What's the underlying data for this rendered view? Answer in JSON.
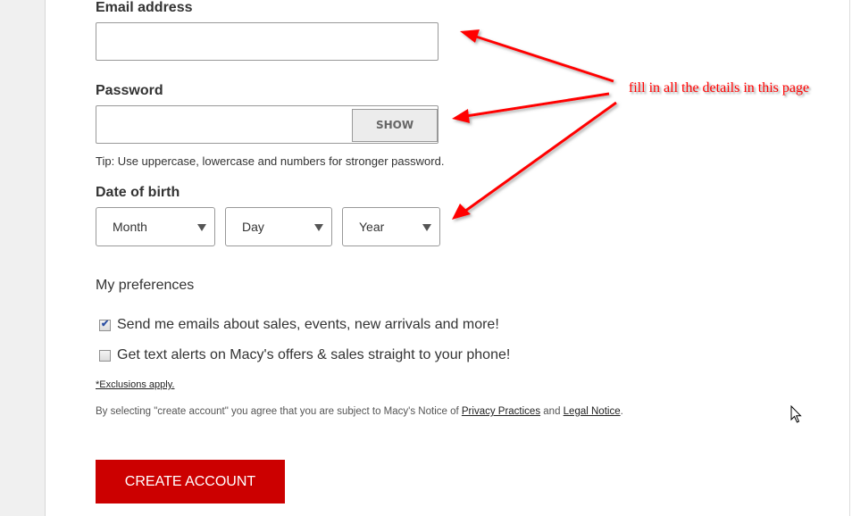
{
  "form": {
    "email": {
      "label": "Email address",
      "value": "",
      "placeholder": ""
    },
    "password": {
      "label": "Password",
      "value": "",
      "placeholder": "",
      "show_button": "SHOW",
      "tip": "Tip: Use uppercase, lowercase and numbers for stronger password."
    },
    "dob": {
      "label": "Date of birth",
      "month": "Month",
      "day": "Day",
      "year": "Year"
    },
    "preferences": {
      "title": "My preferences",
      "options": [
        {
          "label": "Send me emails about sales, events, new arrivals and more!",
          "checked": true
        },
        {
          "label": "Get text alerts on Macy's offers & sales straight to your phone!",
          "checked": false
        }
      ],
      "exclusions_link": "*Exclusions apply."
    },
    "legal": {
      "prefix": "By selecting \"create account\" you agree that you are subject to Macy's Notice of ",
      "privacy_link": "Privacy Practices",
      "conjunction": " and ",
      "legal_link": "Legal Notice",
      "suffix": "."
    },
    "submit_label": "CREATE ACCOUNT"
  },
  "annotation": {
    "text": "fill in all the details in this page",
    "color": "#ff0000"
  },
  "colors": {
    "brand_red": "#cc0000",
    "checkbox_tick": "#2b4fa3"
  }
}
